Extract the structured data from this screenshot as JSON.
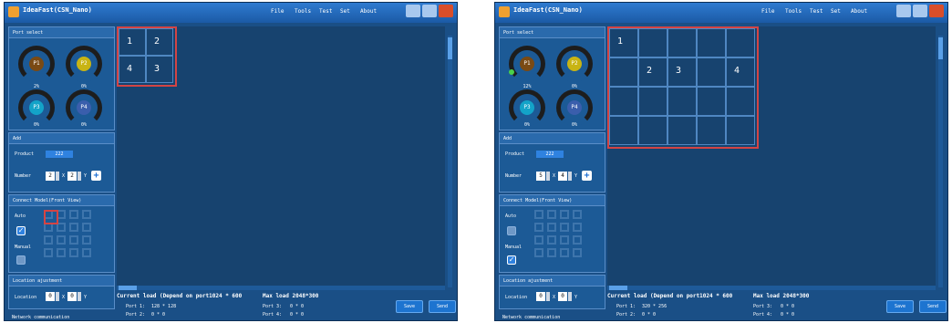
{
  "screens": [
    {
      "title": "IdeaFast(CSN_Nano)",
      "menu": [
        "File",
        "Tools",
        "Test",
        "Set",
        "About"
      ],
      "port_select": {
        "title": "Port select",
        "gauges": [
          {
            "label": "P1",
            "value": "2%",
            "color": "#7a4a14"
          },
          {
            "label": "P2",
            "value": "0%",
            "color": "#c8b414"
          },
          {
            "label": "P3",
            "value": "0%",
            "color": "#13a3c8"
          },
          {
            "label": "P4",
            "value": "0%",
            "color": "#3a5eac"
          }
        ]
      },
      "add": {
        "title": "Add",
        "product_label": "Product",
        "product_value": "222",
        "number_label": "Number",
        "number_x": "2",
        "number_y": "2",
        "x_label": "X",
        "y_label": "Y"
      },
      "connect": {
        "title": "Connect Model(Front View)",
        "auto_label": "Auto",
        "manual_label": "Manual",
        "auto_checked": true,
        "manual_checked": false
      },
      "location": {
        "title": "Location ajustment",
        "label": "Location",
        "x_value": "0",
        "y_value": "0",
        "x_label": "X",
        "y_label": "Y"
      },
      "network_label": "Network communication",
      "grid": {
        "cols": 2,
        "rows": 2,
        "numbers": [
          "1",
          "2",
          "4",
          "3"
        ]
      },
      "status": {
        "current_load": "Current load (Depend on port1024 * 600",
        "max_load": "Max load 2048*300",
        "port1_label": "Port 1:",
        "port1_value": "128 * 128",
        "port2_label": "Port 2:",
        "port2_value": "0 * 0",
        "port3_label": "Port 3:",
        "port3_value": "0 * 0",
        "port4_label": "Port 4:",
        "port4_value": "0 * 0"
      },
      "buttons": {
        "save": "Save",
        "send": "Send"
      }
    },
    {
      "title": "IdeaFast(CSN_Nano)",
      "menu": [
        "File",
        "Tools",
        "Test",
        "Set",
        "About"
      ],
      "port_select": {
        "title": "Port select",
        "gauges": [
          {
            "label": "P1",
            "value": "12%",
            "color": "#7a4a14"
          },
          {
            "label": "P2",
            "value": "0%",
            "color": "#c8b414"
          },
          {
            "label": "P3",
            "value": "0%",
            "color": "#13a3c8"
          },
          {
            "label": "P4",
            "value": "0%",
            "color": "#3a5eac"
          }
        ]
      },
      "add": {
        "title": "Add",
        "product_label": "Product",
        "product_value": "222",
        "number_label": "Number",
        "number_x": "5",
        "number_y": "4",
        "x_label": "X",
        "y_label": "Y"
      },
      "connect": {
        "title": "Connect Model(Front View)",
        "auto_label": "Auto",
        "manual_label": "Manual",
        "auto_checked": false,
        "manual_checked": true
      },
      "location": {
        "title": "Location ajustment",
        "label": "Location",
        "x_value": "0",
        "y_value": "0",
        "x_label": "X",
        "y_label": "Y"
      },
      "network_label": "Network communication",
      "grid": {
        "cols": 5,
        "rows": 4,
        "numbers": [
          "1",
          "",
          "",
          "",
          "",
          "",
          "2",
          "3",
          "",
          "4"
        ]
      },
      "status": {
        "current_load": "Current load (Depend on port1024 * 600",
        "max_load": "Max load 2048*300",
        "port1_label": "Port 1:",
        "port1_value": "320 * 256",
        "port2_label": "Port 2:",
        "port2_value": "0 * 0",
        "port3_label": "Port 3:",
        "port3_value": "0 * 0",
        "port4_label": "Port 4:",
        "port4_value": "0 * 0"
      },
      "buttons": {
        "save": "Save",
        "send": "Send"
      }
    }
  ],
  "icons": [
    "open-folder-icon",
    "save-icon",
    "light-icon",
    "display-icon",
    "lock-icon",
    "undo-icon",
    "search-icon",
    "screen-icon",
    "network-icon"
  ]
}
